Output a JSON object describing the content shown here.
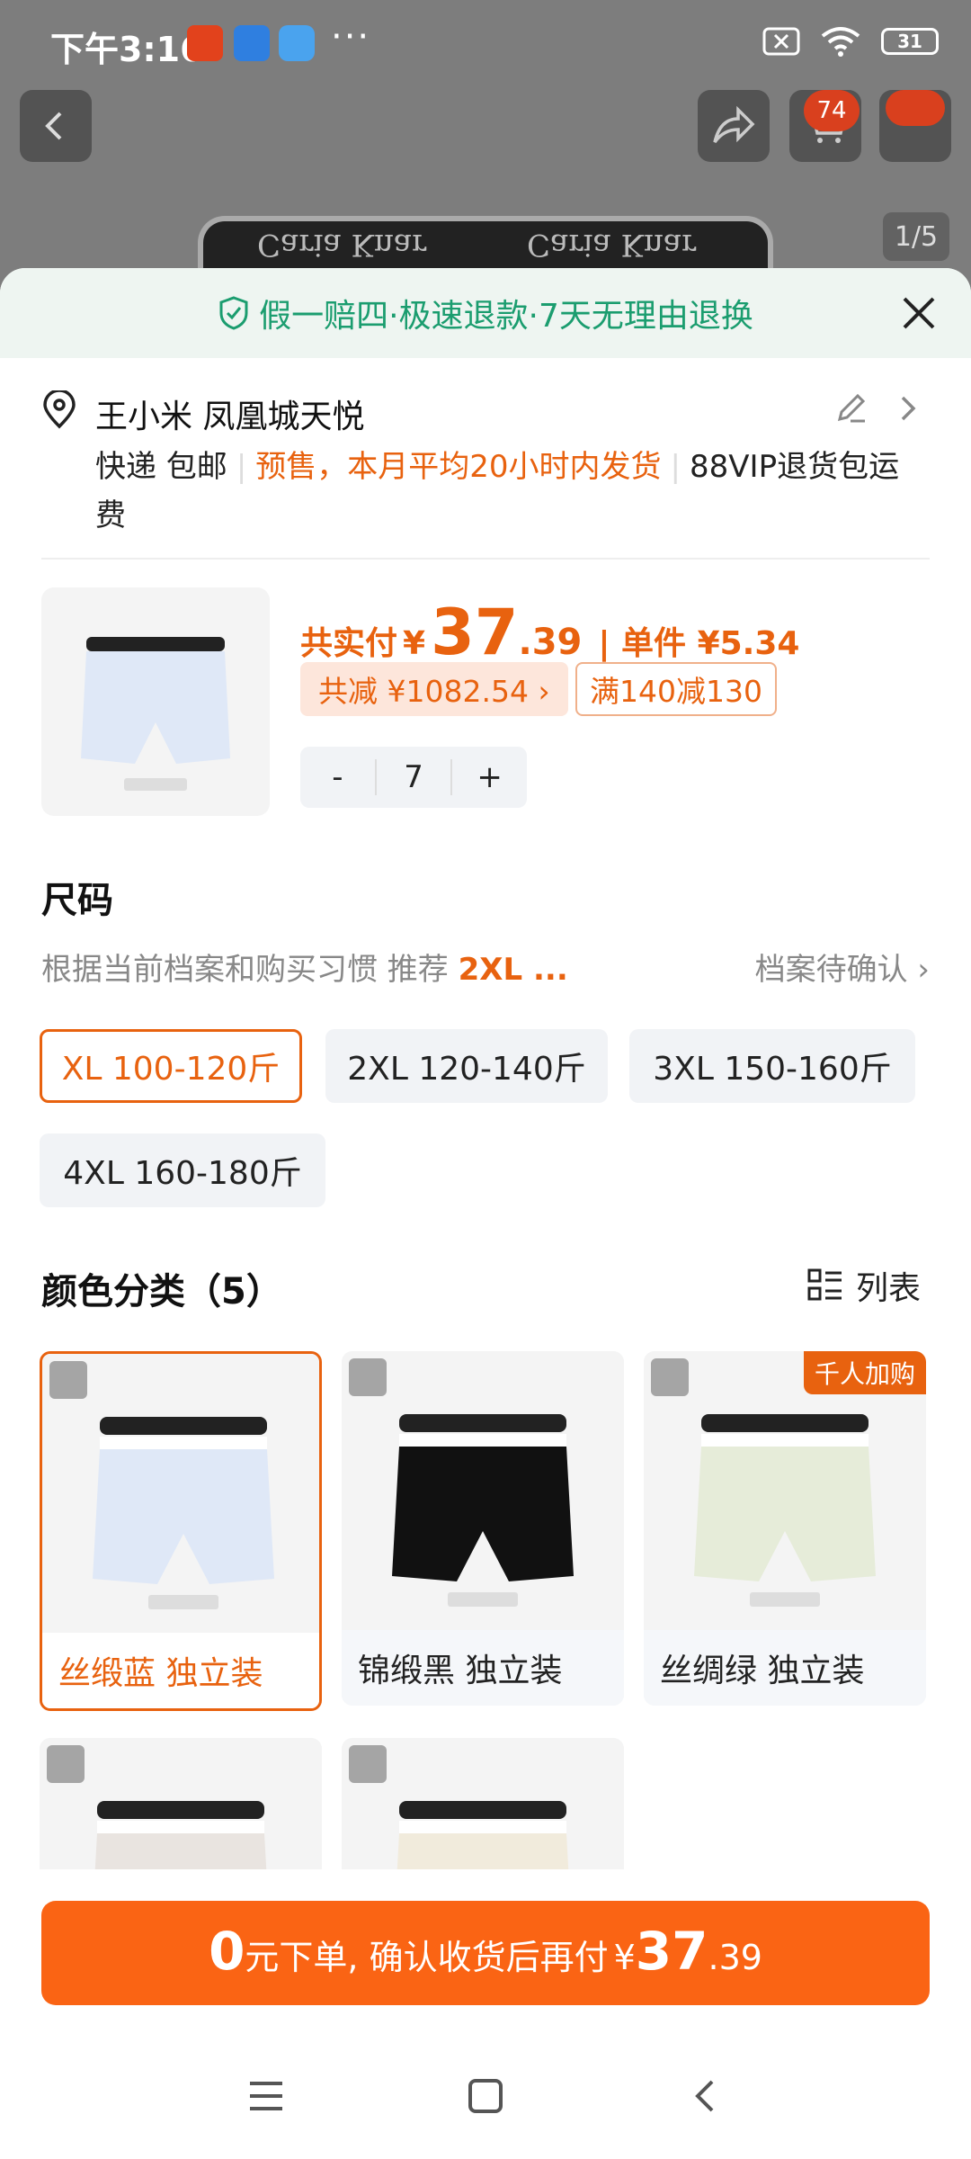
{
  "status": {
    "time": "下午3:16",
    "battery": "31",
    "more": "···"
  },
  "cart_badge": "74",
  "pager": "1/5",
  "brand_text": "Caria Knar",
  "guarantee": "假一赔四·极速退款·7天无理由退换",
  "address": {
    "name": "王小米 凤凰城天悦",
    "delivery": "快递 包邮",
    "presale": "预售，本月平均20小时内发货",
    "vip": "88VIP退货包运费"
  },
  "price": {
    "label": "共实付",
    "currency": "¥",
    "int": "37",
    "dec": ".39",
    "unit": "| 单件 ¥5.34",
    "discount": "共减 ¥1082.54 ›",
    "coupon": "满140减130"
  },
  "qty": {
    "minus": "-",
    "value": "7",
    "plus": "+"
  },
  "size_section": {
    "title": "尺码",
    "rec_text": "根据当前档案和购买习惯 推荐",
    "rec_value": "2XL ...",
    "profile": "档案待确认 ›",
    "options": [
      "XL 100-120斤",
      "2XL 120-140斤",
      "3XL 150-160斤",
      "4XL 160-180斤"
    ],
    "selected": 0
  },
  "color_section": {
    "title": "颜色分类（5）",
    "view_label": "列表",
    "hot_tag": "千人加购",
    "items": [
      {
        "label": "丝缎蓝 独立装",
        "tag": "丝缎蓝",
        "color": "#dfe8f7"
      },
      {
        "label": "锦缎黑 独立装",
        "tag": "锦缎黑",
        "color": "#111111"
      },
      {
        "label": "丝绸绿 独立装",
        "tag": "丝绸绿",
        "color": "#e6ecd9"
      },
      {
        "color": "#e9e4e0"
      },
      {
        "color": "#f1ebdc"
      }
    ]
  },
  "cta": {
    "zero": "0",
    "text1": "元下单, 确认收货后再付",
    "currency": "¥",
    "int": "37",
    "dec": ".39"
  },
  "colors": {
    "accent": "#fa6414",
    "green": "#1b9d6f"
  }
}
